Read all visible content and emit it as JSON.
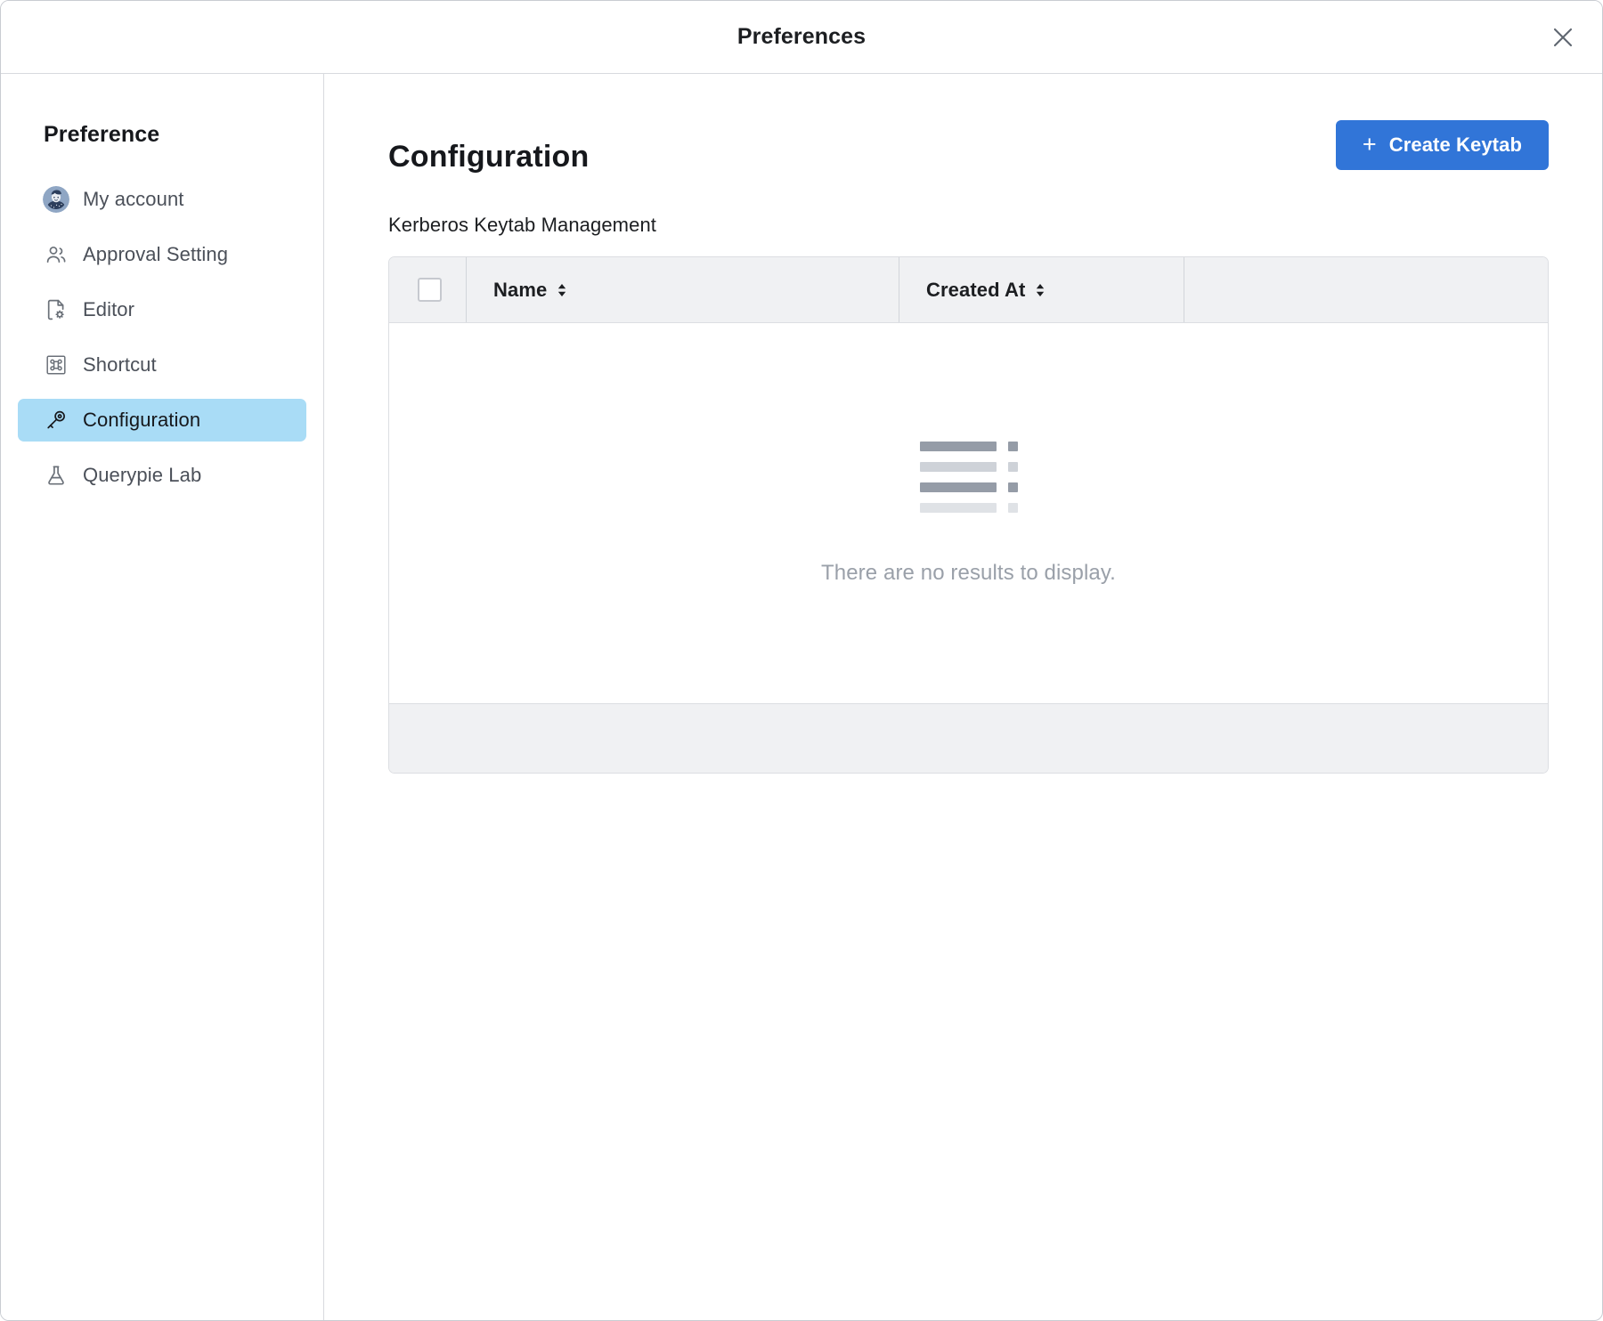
{
  "window": {
    "title": "Preferences",
    "close_icon": "close-icon"
  },
  "sidebar": {
    "heading": "Preference",
    "items": [
      {
        "label": "My account",
        "icon": "avatar-icon",
        "active": false
      },
      {
        "label": "Approval Setting",
        "icon": "users-icon",
        "active": false
      },
      {
        "label": "Editor",
        "icon": "document-gear-icon",
        "active": false
      },
      {
        "label": "Shortcut",
        "icon": "command-key-icon",
        "active": false
      },
      {
        "label": "Configuration",
        "icon": "key-icon",
        "active": true
      },
      {
        "label": "Querypie Lab",
        "icon": "flask-icon",
        "active": false
      }
    ]
  },
  "main": {
    "page_title": "Configuration",
    "create_button": {
      "label": "Create Keytab",
      "plus": "+",
      "color": "#3175d8"
    },
    "section_label": "Kerberos Keytab Management",
    "table": {
      "columns": [
        {
          "key": "select",
          "label": "",
          "sortable": false
        },
        {
          "key": "name",
          "label": "Name",
          "sortable": true
        },
        {
          "key": "created_at",
          "label": "Created At",
          "sortable": true
        },
        {
          "key": "actions",
          "label": "",
          "sortable": false
        }
      ],
      "rows": [],
      "select_all_checked": false,
      "empty_message": "There are no results to display."
    }
  },
  "colors": {
    "accent": "#3175d8",
    "active_nav_bg": "#a9dcf6",
    "table_header_bg": "#f0f1f3",
    "border": "#dcdee2",
    "muted_text": "#9aa0a9"
  }
}
